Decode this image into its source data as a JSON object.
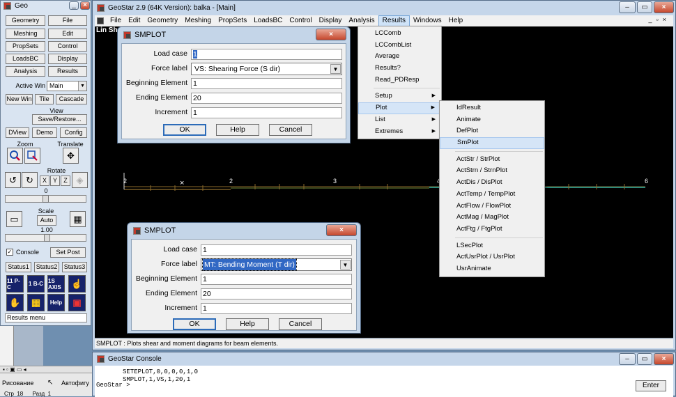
{
  "tool_panel": {
    "title": "Geo",
    "rows": [
      [
        "Geometry",
        "File"
      ],
      [
        "Meshing",
        "Edit"
      ],
      [
        "PropSets",
        "Control"
      ],
      [
        "LoadsBC",
        "Display"
      ],
      [
        "Analysis",
        "Results"
      ]
    ],
    "active_win_label": "Active Win",
    "active_win_value": "Main",
    "new_win": "New Win",
    "tile": "Tile",
    "cascade": "Cascade",
    "view_label": "View",
    "save_restore": "Save/Restore...",
    "dview": "DView",
    "demo": "Demo",
    "config": "Config",
    "zoom_label": "Zoom",
    "translate_label": "Translate",
    "rotate_label": "Rotate",
    "rotate_axes": [
      "X",
      "Y",
      "Z"
    ],
    "rotate_value": "0",
    "scale_label": "Scale",
    "scale_auto": "Auto",
    "scale_value": "1.00",
    "console_label": "Console",
    "console_checked": true,
    "set_post": "Set Post",
    "status_tabs": [
      "Status1",
      "Status2",
      "Status3"
    ],
    "status_text": "Results menu",
    "tool_icons_row1": [
      "11 P-C",
      "1 B-C",
      "1S AXIS",
      "help-pointer"
    ],
    "tool_icons_row2": [
      "hand",
      "grid",
      "Help",
      "book"
    ]
  },
  "main_window": {
    "title": "GeoStar 2.9 (64K Version): balka - [Main]",
    "menus": [
      "File",
      "Edit",
      "Geometry",
      "Meshing",
      "PropSets",
      "LoadsBC",
      "Control",
      "Display",
      "Analysis",
      "Results",
      "Windows",
      "Help"
    ],
    "active_menu": "Results",
    "canvas_label": "Lin Sh",
    "nodes": [
      "2",
      "2",
      "3",
      "4",
      "6"
    ],
    "status_line": "SMPLOT : Plots shear and moment diagrams for beam elements."
  },
  "results_menu": {
    "items": [
      "LCComb",
      "LCCombList",
      "Average",
      "Results?",
      "Read_PDResp"
    ],
    "submenus": [
      "Setup",
      "Plot",
      "List",
      "Extremes"
    ],
    "highlighted": "Plot"
  },
  "plot_submenu": {
    "group1": [
      "IdResult",
      "Animate",
      "DefPlot",
      "SmPlot"
    ],
    "group2": [
      "ActStr / StrPlot",
      "ActStrn / StrnPlot",
      "ActDis / DisPlot",
      "ActTemp / TempPlot",
      "ActFlow / FlowPlot",
      "ActMag / MagPlot",
      "ActFtg / FtgPlot"
    ],
    "group3": [
      "LSecPlot",
      "ActUsrPlot / UsrPlot",
      "UsrAnimate"
    ],
    "highlighted": "SmPlot"
  },
  "dialog_shear": {
    "title": "SMPLOT",
    "load_case_label": "Load case",
    "load_case": "1",
    "force_label": "Force label",
    "force_value": "VS: Shearing Force (S dir)",
    "begin_label": "Beginning Element",
    "begin_value": "1",
    "end_label": "Ending Element",
    "end_value": "20",
    "inc_label": "Increment",
    "inc_value": "1",
    "ok": "OK",
    "help": "Help",
    "cancel": "Cancel"
  },
  "dialog_moment": {
    "title": "SMPLOT",
    "load_case_label": "Load case",
    "load_case": "1",
    "force_label": "Force label",
    "force_value": "MT: Bending Moment (T dir)",
    "begin_label": "Beginning Element",
    "begin_value": "1",
    "end_label": "Ending Element",
    "end_value": "20",
    "inc_label": "Increment",
    "inc_value": "1",
    "ok": "OK",
    "help": "Help",
    "cancel": "Cancel"
  },
  "console": {
    "title": "GeoStar Console",
    "prompt": "GeoStar >",
    "lines": [
      "SETEPLOT,0,0,0,0,1,0",
      "SMPLOT,1,VS,1,20,1"
    ],
    "enter": "Enter"
  },
  "taskbar": {
    "drawing_menu": "Рисование",
    "autoshapes": "Автофигу",
    "page_line": "Стр  18      Разд  1"
  },
  "colors": {
    "canvas": "#000000",
    "beam": "#8b6a2a",
    "beam_right": "#2f8a7c",
    "dialog_frame": "#c4d5e8",
    "selection": "#3168c4"
  }
}
